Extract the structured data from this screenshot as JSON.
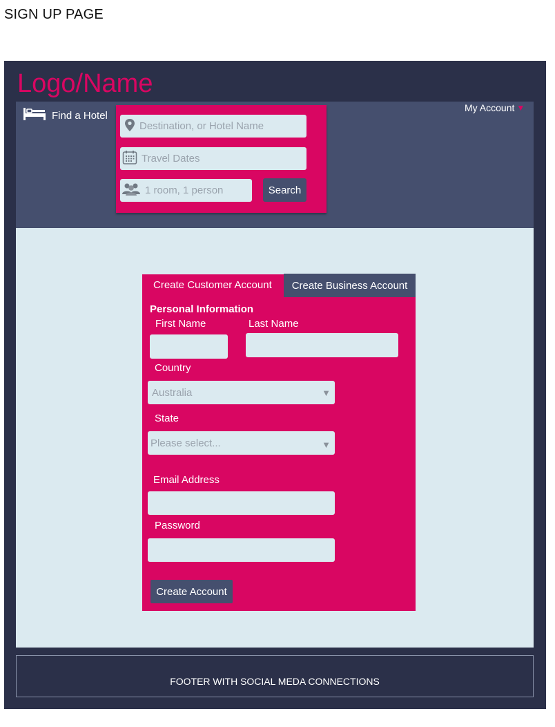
{
  "page": {
    "caption": "SIGN UP PAGE"
  },
  "header": {
    "logo": "Logo/Name",
    "find_hotel": "Find a Hotel",
    "my_account": "My Account",
    "search": {
      "destination_placeholder": "Destination, or Hotel Name",
      "dates_placeholder": "Travel Dates",
      "rooms_placeholder": "1 room, 1 person",
      "button": "Search"
    }
  },
  "form": {
    "tabs": [
      {
        "label": "Create Customer Account",
        "active": true
      },
      {
        "label": "Create Business Account",
        "active": false
      }
    ],
    "section_title": "Personal Information",
    "first_name_label": "First Name",
    "last_name_label": "Last Name",
    "country_label": "Country",
    "country_value": "Australia",
    "state_label": "State",
    "state_value": "Please select...",
    "email_label": "Email Address",
    "password_label": "Password",
    "submit": "Create Account"
  },
  "footer": {
    "text": "FOOTER WITH SOCIAL MEDA CONNECTIONS"
  },
  "colors": {
    "accent": "#d90662",
    "dark": "#2b3049",
    "mid": "#454f6e",
    "light": "#dbeaf0"
  }
}
